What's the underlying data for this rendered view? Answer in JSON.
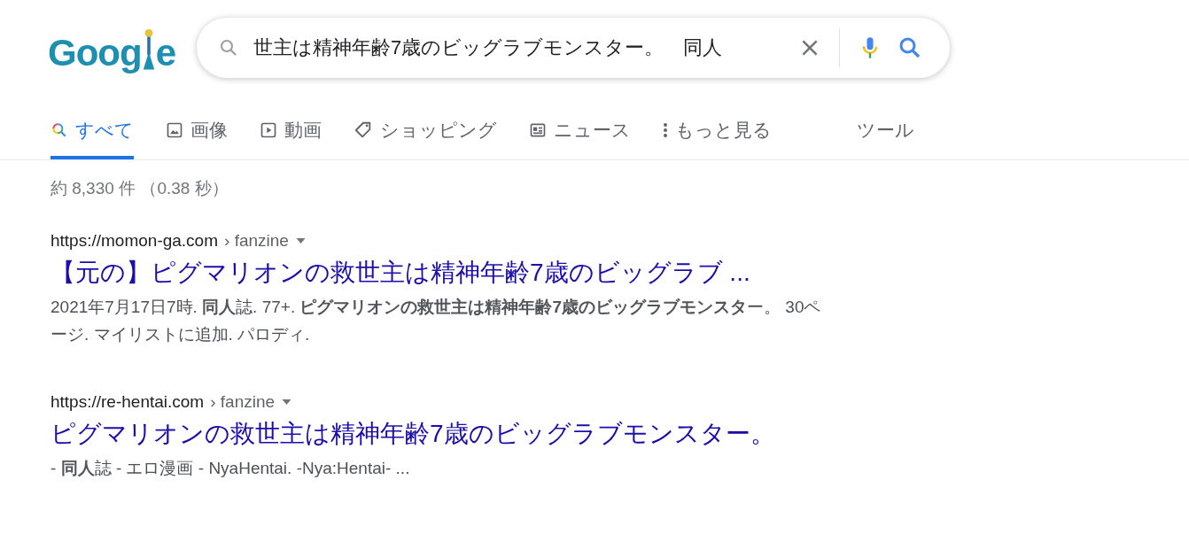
{
  "logo": {
    "text_before": "Goog",
    "text_after": "e"
  },
  "search": {
    "value": "世主は精神年齢7歳のビッグラブモンスター。　同人"
  },
  "tabs": [
    {
      "kind": "all",
      "label": "すべて",
      "selected": true
    },
    {
      "kind": "images",
      "label": "画像",
      "selected": false
    },
    {
      "kind": "videos",
      "label": "動画",
      "selected": false
    },
    {
      "kind": "shopping",
      "label": "ショッピング",
      "selected": false
    },
    {
      "kind": "news",
      "label": "ニュース",
      "selected": false
    },
    {
      "kind": "more",
      "label": "もっと見る",
      "selected": false
    }
  ],
  "tools": "ツール",
  "result_stats": "約 8,330 件 （0.38 秒）",
  "results": [
    {
      "url": "https://momon-ga.com",
      "breadcrumb": "› fanzine",
      "title": "【元の】ピグマリオンの救世主は精神年齢7歳のビッグラブ ...",
      "snippet": "2021年7月17日7時. **同人**誌. 77+. **ピグマリオンの救世主は精神年齢7歳のビッグラブモンスタ**ー。 30ページ. マイリストに追加. パロディ."
    },
    {
      "url": "https://re-hentai.com",
      "breadcrumb": "› fanzine",
      "title": "ピグマリオンの救世主は精神年齢7歳のビッグラブモンスター。",
      "snippet": "- **同人**誌 - エロ漫画 - NyaHentai. -Nya:Hentai- ..."
    }
  ]
}
